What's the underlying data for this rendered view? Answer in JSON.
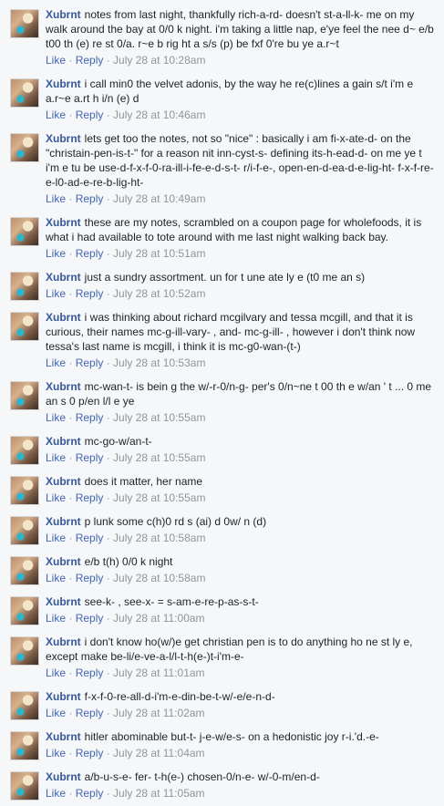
{
  "labels": {
    "like": "Like",
    "reply": "Reply",
    "dot": "·"
  },
  "comments": [
    {
      "author": "Xubrnt",
      "text": "notes from last night, thankfully rich-a-rd- doesn't st-a-ll-k- me on my walk around the bay at 0/0 k night. i'm taking a little nap, e'ye feel the nee d~ e/b t00 th (e) re st 0/a. r~e b rig ht a s/s (p) be fxf 0're bu ye a.r~t",
      "time": "July 28 at 10:28am"
    },
    {
      "author": "Xubrnt",
      "text": "i call min0 the velvet adonis, by the way he re(c)lines a gain s/t i'm e a.r~e a.rt h i/n (e) d",
      "time": "July 28 at 10:46am"
    },
    {
      "author": "Xubrnt",
      "text": "lets get too the notes, not so \"nice\" : basically i am fi-x-ate-d- on the \"christain-pen-is-t-\" for a reason nit inn-cyst-s- defining its-h-ead-d- on me ye t i'm e tu be use-d-f-x-f-0-ra-ill-i-fe-e-d-s-t- r/i-f-e-, open-en-d-ea-d-e-lig-ht- f-x-f-re-e-l0-ad-e-re-b-lig-ht-",
      "time": "July 28 at 10:49am"
    },
    {
      "author": "Xubrnt",
      "text": "these are my notes, scrambled on a coupon page for wholefoods, it is what i had available to tote around with me last night walking back bay.",
      "time": "July 28 at 10:51am"
    },
    {
      "author": "Xubrnt",
      "text": "just a sundry assortment. un for t une ate ly e (t0 me an s)",
      "time": "July 28 at 10:52am"
    },
    {
      "author": "Xubrnt",
      "text": "i was thinking about richard mcgilvary and tessa mcgill, and that it is curious, their names mc-g-ill-vary- , and- mc-g-ill- , however i don't think now tessa's last name is mcgill, i think it is mc-g0-wan-(t-)",
      "time": "July 28 at 10:53am"
    },
    {
      "author": "Xubrnt",
      "text": "mc-wan-t- is bein g the w/-r-0/n-g- per's 0/n~ne t 00 th e w/an ' t ... 0 me an s 0 p/en l/l e ye",
      "time": "July 28 at 10:55am"
    },
    {
      "author": "Xubrnt",
      "text": "mc-go-w/an-t-",
      "time": "July 28 at 10:55am"
    },
    {
      "author": "Xubrnt",
      "text": "does it matter, her name",
      "time": "July 28 at 10:55am"
    },
    {
      "author": "Xubrnt",
      "text": "p lunk some c(h)0 rd s (ai) d 0w/ n (d)",
      "time": "July 28 at 10:58am"
    },
    {
      "author": "Xubrnt",
      "text": "e/b t(h) 0/0 k night",
      "time": "July 28 at 10:58am"
    },
    {
      "author": "Xubrnt",
      "text": "see-k- , see-x- = s-am-e-re-p-as-s-t-",
      "time": "July 28 at 11:00am"
    },
    {
      "author": "Xubrnt",
      "text": "i don't know ho(w/)e get christian pen is to do anything ho ne st ly e, except make be-li/e-ve-a-l/l-t-h(e-)t-i'm-e-",
      "time": "July 28 at 11:01am"
    },
    {
      "author": "Xubrnt",
      "text": "f-x-f-0-re-all-d-i'm-e-din-be-t-w/-e/e-n-d-",
      "time": "July 28 at 11:02am"
    },
    {
      "author": "Xubrnt",
      "text": "hitler abominable but-t- j-e-w/e-s- on a hedonistic joy r-i.'d.-e-",
      "time": "July 28 at 11:04am"
    },
    {
      "author": "Xubrnt",
      "text": "a/b-u-s-e- fer- t-h(e-) chosen-0/n-e- w/-0-m/en-d-",
      "time": "July 28 at 11:05am"
    }
  ]
}
